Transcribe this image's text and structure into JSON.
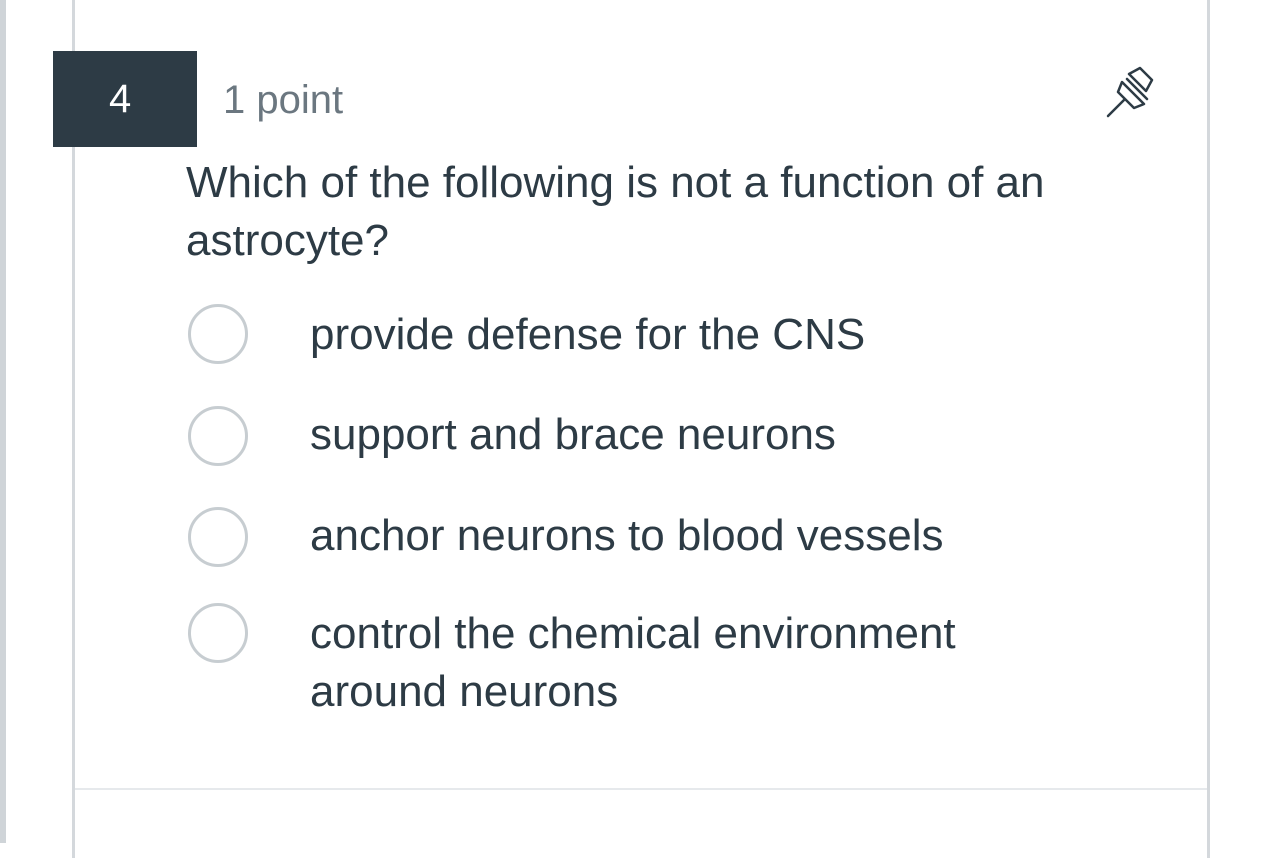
{
  "question": {
    "number": "4",
    "points": "1 point",
    "text": "Which of the following is not a function of an astrocyte?",
    "pin_icon": "pin-icon",
    "options": [
      {
        "label": "provide defense for the CNS"
      },
      {
        "label": "support and brace neurons"
      },
      {
        "label": "anchor neurons to blood vessels"
      },
      {
        "label": "control the chemical environment around neurons"
      }
    ]
  },
  "colors": {
    "header_bg": "#2d3b45",
    "text": "#2d3b45",
    "muted_text": "#6b7780",
    "radio_border": "#c7cdd1"
  }
}
